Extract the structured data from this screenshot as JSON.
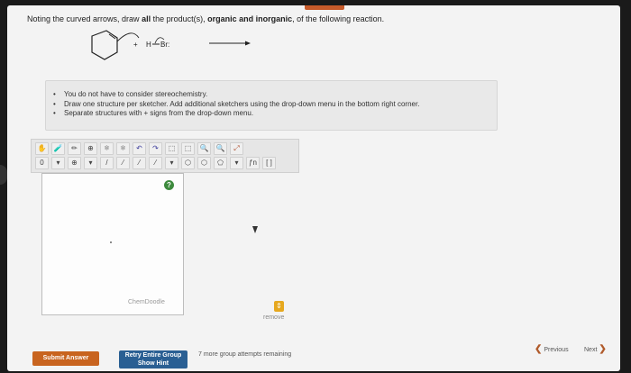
{
  "question": {
    "prefix": "Noting the curved arrows, draw ",
    "bold1": "all",
    "middle": " the product(s), ",
    "bold2": "organic and inorganic",
    "suffix": ", of the following reaction."
  },
  "reaction": {
    "reagent_H": "H",
    "reagent_Br": "Br:"
  },
  "notes": [
    "You do not have to consider stereochemistry.",
    "Draw one structure per sketcher. Add additional sketchers using the drop-down menu in the bottom right corner.",
    "Separate structures with + signs from the drop-down menu."
  ],
  "sketcher": {
    "toolbar_row1": [
      "✋",
      "🧪",
      "✏",
      "⊕",
      "⚛",
      "⚛",
      "↶",
      "↷",
      "⬚",
      "⬚",
      "🔍",
      "🔍",
      "⤢"
    ],
    "toolbar_row2": [
      "0",
      "▾",
      "⊕",
      "▾",
      "/",
      "⁄",
      "⁄",
      "⁄",
      "▾",
      "⬡",
      "⬡",
      "⬠",
      "▾",
      "ƒn",
      "[ ]"
    ],
    "help_label": "?",
    "branding": "ChemDoodle",
    "remove_label": "remove"
  },
  "footer": {
    "submit_label": "Submit Answer",
    "retry_label": "Retry Entire Group",
    "hint_label": "Show Hint",
    "attempts_text": "7 more group attempts remaining",
    "previous_label": "Previous",
    "next_label": "Next"
  },
  "colors": {
    "submit": "#c8641f",
    "retry": "#2a5f93",
    "help": "#3d8a3d",
    "select": "#e6a81f"
  }
}
